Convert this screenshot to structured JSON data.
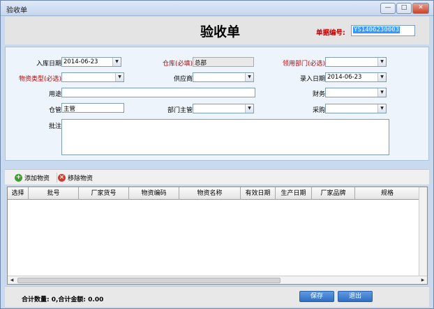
{
  "window": {
    "title": "验收单",
    "min_glyph": "—",
    "max_glyph": "□",
    "close_glyph": "✕"
  },
  "header": {
    "title": "验收单",
    "docno_label": "单据编号:",
    "docno_value": "YS1406230003"
  },
  "form": {
    "entry_date_label": "入库日期",
    "entry_date_value": "2014-06-23",
    "warehouse_label": "仓库(必填)",
    "warehouse_value": "总部",
    "dept_label": "领用部门(必选)",
    "dept_value": "",
    "material_type_label": "物资类型(必选)",
    "material_type_value": "",
    "supplier_label": "供应商",
    "supplier_value": "",
    "record_date_label": "录入日期",
    "record_date_value": "2014-06-23",
    "usage_label": "用途",
    "usage_value": "",
    "finance_label": "财务",
    "finance_value": "",
    "keeper_label": "仓管",
    "keeper_value": "主管",
    "dept_head_label": "部门主管",
    "dept_head_value": "",
    "purchase_label": "采购",
    "purchase_value": "",
    "remark_label": "批注",
    "remark_value": ""
  },
  "toolbar": {
    "add_label": "添加物资",
    "remove_label": "移除物资"
  },
  "grid": {
    "columns": [
      "选择",
      "批号",
      "厂家货号",
      "物资编码",
      "物资名称",
      "有效日期",
      "生产日期",
      "厂家品牌",
      "规格"
    ]
  },
  "footer": {
    "summary": "合计数量: 0,合计金额: 0.00",
    "save_label": "保存",
    "exit_label": "退出"
  },
  "colors": {
    "required_label": "#c00000",
    "button_blue": "#2f6fc4",
    "selection": "#3399ff"
  }
}
